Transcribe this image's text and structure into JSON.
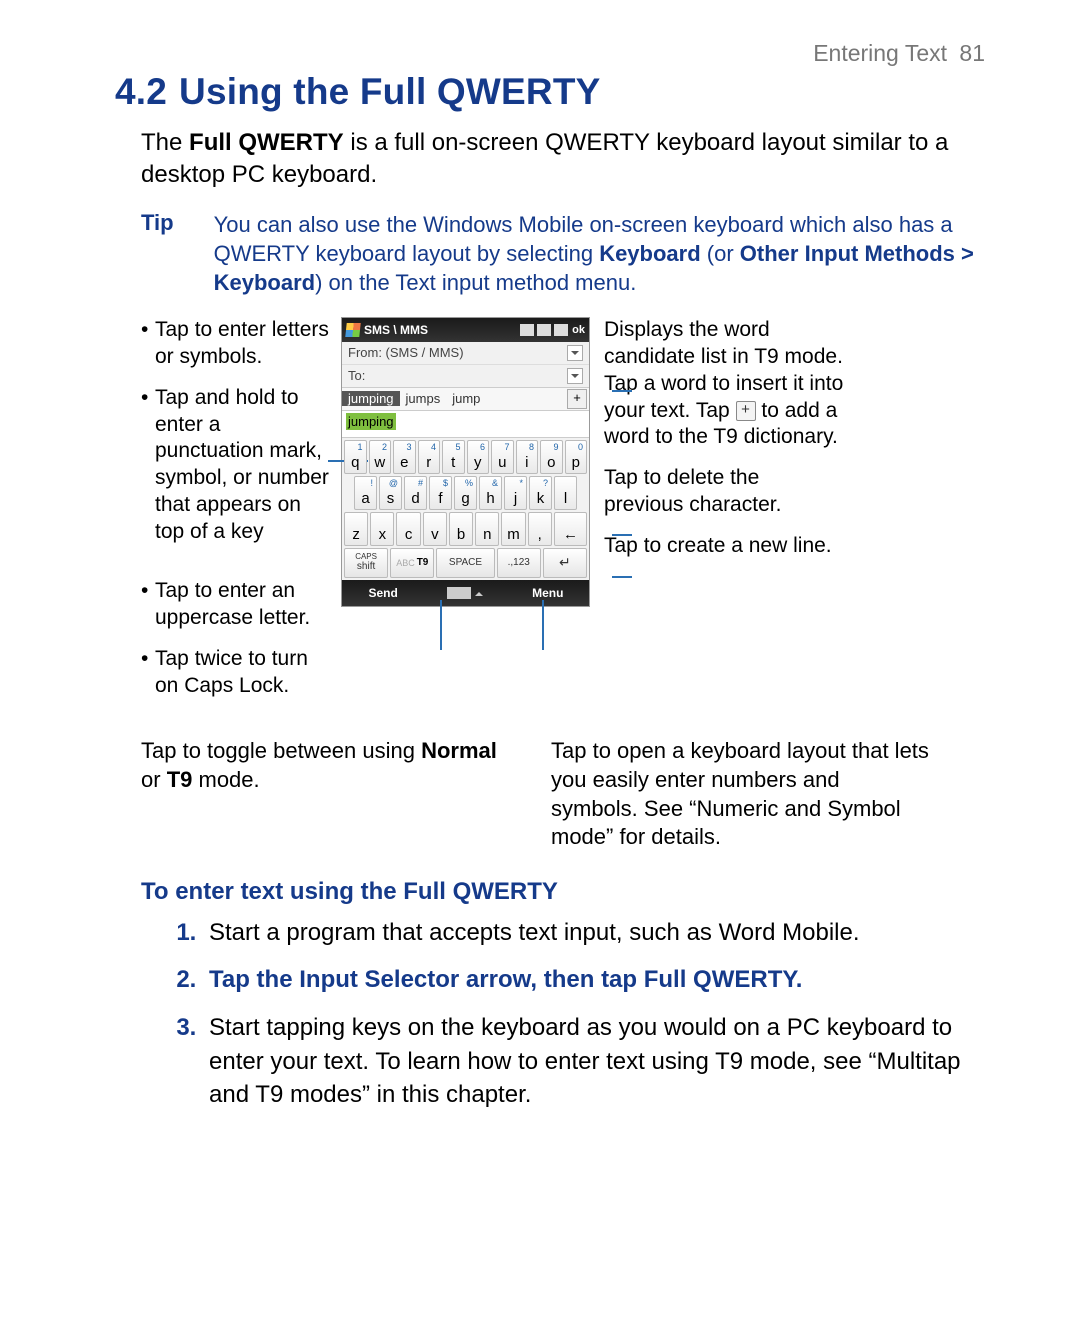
{
  "header": {
    "section": "Entering Text",
    "page": "81"
  },
  "title": {
    "num": "4.2",
    "text": "Using the Full QWERTY"
  },
  "intro": {
    "pre": "The ",
    "bold": "Full QWERTY",
    "post": " is a full on-screen QWERTY keyboard layout similar to a desktop PC keyboard."
  },
  "tip": {
    "label": "Tip",
    "t1": "You can also use the Windows Mobile on-screen keyboard which also has a QWERTY keyboard layout by selecting ",
    "b1": "Keyboard",
    "t2": " (or ",
    "b2": "Other Input Methods > Keyboard",
    "t3": ") on the Text input method menu."
  },
  "leftnotes": {
    "a": "Tap to enter letters or symbols.",
    "b": "Tap and hold to enter a punctuation mark, symbol, or number that appears on top of a key",
    "c": "Tap to enter an uppercase letter.",
    "d": "Tap twice to turn on Caps Lock."
  },
  "rightnotes": {
    "candlist_a": "Displays the word candidate list in T9 mode. Tap a word to insert it into your text. Tap ",
    "candlist_b": " to add a word to the T9 dictionary.",
    "del": "Tap to delete the previous character.",
    "enter": "Tap to create a new line."
  },
  "belowcap": {
    "left_a": "Tap to toggle between using ",
    "left_b1": "Normal",
    "left_mid": " or ",
    "left_b2": "T9",
    "left_end": " mode.",
    "right": "Tap to open a keyboard layout that lets you easily enter numbers and symbols. See “Numeric and Symbol mode” for details."
  },
  "sub": "To enter text using the Full QWERTY",
  "steps": {
    "s1": "Start a program that accepts text input, such as Word Mobile.",
    "s2_a": "Tap the ",
    "s2_b1": "Input Selector",
    "s2_mid": " arrow, then tap ",
    "s2_b2": "Full QWERTY",
    "s2_end": ".",
    "s3": "Start tapping keys on the keyboard as you would on a PC keyboard to enter your text. To learn how to enter text using T9 mode, see “Multitap and T9 modes” in this chapter."
  },
  "phone": {
    "title": "SMS \\ MMS",
    "ok": "ok",
    "from": "From: (SMS / MMS)",
    "to": "To:",
    "cand": {
      "a": "jumping",
      "b": "jumps",
      "c": "jump"
    },
    "typed": "jumping",
    "row1_sm": [
      "1",
      "2",
      "3",
      "4",
      "5",
      "6",
      "7",
      "8",
      "9",
      "0"
    ],
    "row1_bg": [
      "q",
      "w",
      "e",
      "r",
      "t",
      "y",
      "u",
      "i",
      "o",
      "p"
    ],
    "row2_sm": [
      "!",
      "@",
      "#",
      "$",
      "%",
      "&",
      "*",
      "?",
      ""
    ],
    "row2_bg": [
      "a",
      "s",
      "d",
      "f",
      "g",
      "h",
      "j",
      "k",
      "l"
    ],
    "row3_bg": [
      "z",
      "x",
      "c",
      "v",
      "b",
      "n",
      "m",
      ","
    ],
    "fn": {
      "caps": "CAPS",
      "shift": "shift",
      "abc": "ABC",
      "t9": "T9",
      "space": "SPACE",
      "num": ".,123"
    },
    "soft": {
      "send": "Send",
      "menu": "Menu"
    }
  }
}
